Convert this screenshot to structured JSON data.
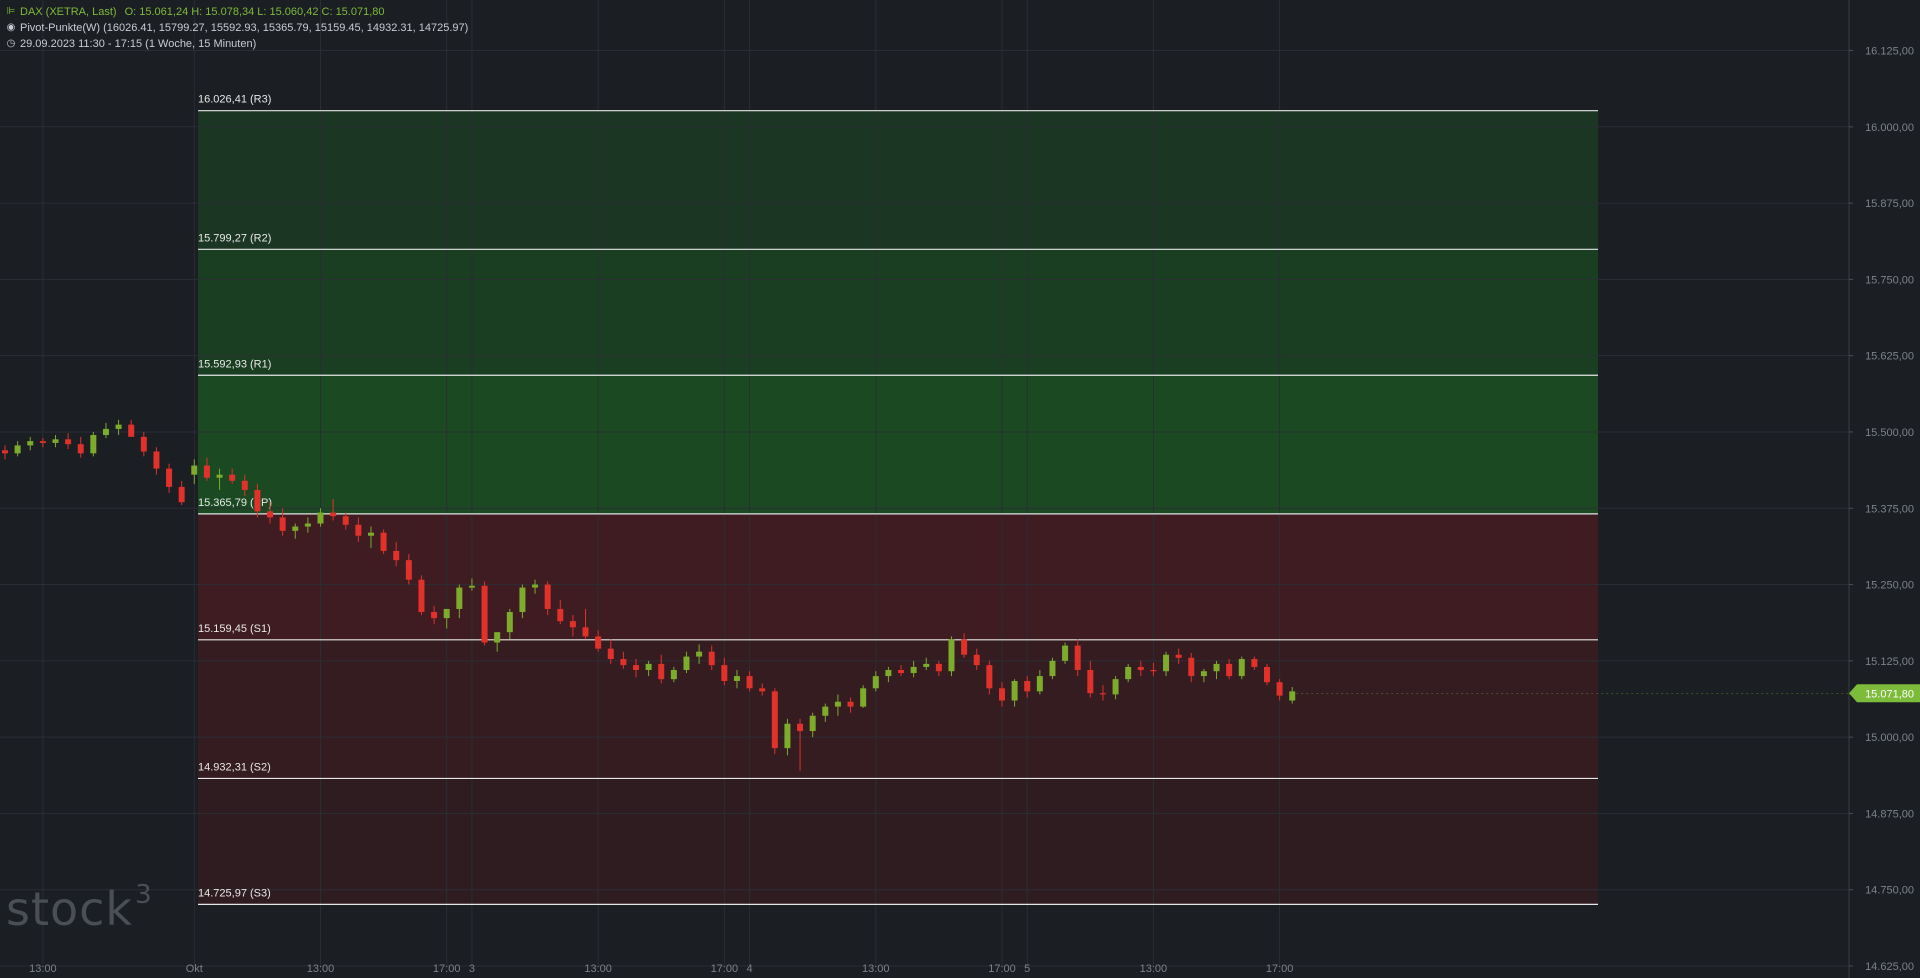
{
  "legend": {
    "symbol_icon": "candlestick-icon",
    "symbol": "DAX (XETRA, Last)",
    "ohlc": "O: 15.061,24  H: 15.078,34  L: 15.060,42  C: 15.071,80",
    "indicator_icon": "target-icon",
    "indicator": "Pivot-Punkte(W)  (16026.41,  15799.27,  15592.93,  15365.79,  15159.45,  14932.31,  14725.97)",
    "period_icon": "clock-icon",
    "period": "29.09.2023 11:30 - 17:15   (1 Woche, 15 Minuten)"
  },
  "logo": {
    "text": "stock",
    "sup": "3"
  },
  "colors": {
    "background": "#1b1e23",
    "up": "#7dab2c",
    "down": "#e0312b",
    "resistance_zone": "#1b4a22",
    "support_zone": "#3f1c21",
    "grid": "#2a2e34",
    "axis_text": "#7d828a",
    "price_tag": "#7dbb3a"
  },
  "chart_data": {
    "type": "candlestick",
    "y_axis": {
      "ticks": [
        "16.125,00",
        "16.000,00",
        "15.875,00",
        "15.750,00",
        "15.625,00",
        "15.500,00",
        "15.375,00",
        "15.250,00",
        "15.125,00",
        "15.000,00",
        "14.875,00",
        "14.750,00",
        "14.625,00"
      ],
      "tick_values": [
        16125,
        16000,
        15875,
        15750,
        15625,
        15500,
        15375,
        15250,
        15125,
        15000,
        14875,
        14750,
        14625
      ],
      "range": [
        14625,
        16175
      ]
    },
    "x_axis": {
      "tick_labels": [
        "13:00",
        "Okt",
        "13:00",
        "17:00",
        "3",
        "13:00",
        "17:00",
        "4",
        "13:00",
        "17:00",
        "5",
        "13:00",
        "17:00"
      ],
      "tick_index": [
        3,
        15,
        25,
        35,
        37,
        47,
        57,
        59,
        69,
        79,
        81,
        91,
        101
      ]
    },
    "pivot_levels": [
      {
        "label": "16.026,41 (R3)",
        "value": 16026.41
      },
      {
        "label": "15.799,27 (R2)",
        "value": 15799.27
      },
      {
        "label": "15.592,93 (R1)",
        "value": 15592.93
      },
      {
        "label": "15.365,79 (PP)",
        "value": 15365.79
      },
      {
        "label": "15.159,45 (S1)",
        "value": 15159.45
      },
      {
        "label": "14.932,31 (S2)",
        "value": 14932.31
      },
      {
        "label": "14.725,97 (S3)",
        "value": 14725.97
      }
    ],
    "last_price": {
      "label": "15.071,80",
      "value": 15071.8
    },
    "candles": [
      [
        15470,
        15478,
        15455,
        15465
      ],
      [
        15465,
        15485,
        15460,
        15478
      ],
      [
        15478,
        15492,
        15470,
        15485
      ],
      [
        15485,
        15490,
        15475,
        15482
      ],
      [
        15482,
        15495,
        15475,
        15488
      ],
      [
        15488,
        15498,
        15472,
        15480
      ],
      [
        15480,
        15492,
        15458,
        15465
      ],
      [
        15465,
        15500,
        15460,
        15495
      ],
      [
        15495,
        15515,
        15490,
        15505
      ],
      [
        15505,
        15520,
        15495,
        15512
      ],
      [
        15512,
        15520,
        15500,
        15492
      ],
      [
        15492,
        15500,
        15460,
        15468
      ],
      [
        15468,
        15475,
        15430,
        15440
      ],
      [
        15440,
        15448,
        15400,
        15410
      ],
      [
        15410,
        15420,
        15380,
        15385
      ],
      [
        15430,
        15455,
        15415,
        15445
      ],
      [
        15445,
        15458,
        15420,
        15425
      ],
      [
        15425,
        15440,
        15405,
        15430
      ],
      [
        15430,
        15440,
        15415,
        15420
      ],
      [
        15420,
        15430,
        15395,
        15405
      ],
      [
        15405,
        15415,
        15360,
        15370
      ],
      [
        15370,
        15385,
        15350,
        15360
      ],
      [
        15360,
        15375,
        15330,
        15338
      ],
      [
        15338,
        15350,
        15325,
        15345
      ],
      [
        15345,
        15360,
        15335,
        15350
      ],
      [
        15350,
        15375,
        15345,
        15368
      ],
      [
        15368,
        15390,
        15355,
        15362
      ],
      [
        15362,
        15368,
        15340,
        15348
      ],
      [
        15348,
        15360,
        15320,
        15330
      ],
      [
        15330,
        15345,
        15310,
        15335
      ],
      [
        15335,
        15340,
        15300,
        15305
      ],
      [
        15305,
        15320,
        15280,
        15290
      ],
      [
        15290,
        15300,
        15250,
        15258
      ],
      [
        15258,
        15265,
        15200,
        15205
      ],
      [
        15205,
        15215,
        15185,
        15195
      ],
      [
        15195,
        15210,
        15178,
        15210
      ],
      [
        15210,
        15250,
        15195,
        15245
      ],
      [
        15245,
        15260,
        15240,
        15248
      ],
      [
        15248,
        15255,
        15150,
        15155
      ],
      [
        15155,
        15170,
        15140,
        15172
      ],
      [
        15172,
        15210,
        15160,
        15205
      ],
      [
        15205,
        15250,
        15195,
        15245
      ],
      [
        15245,
        15258,
        15235,
        15250
      ],
      [
        15250,
        15255,
        15200,
        15210
      ],
      [
        15210,
        15225,
        15185,
        15190
      ],
      [
        15190,
        15200,
        15165,
        15180
      ],
      [
        15180,
        15210,
        15160,
        15165
      ],
      [
        15165,
        15175,
        15140,
        15145
      ],
      [
        15145,
        15160,
        15120,
        15128
      ],
      [
        15128,
        15140,
        15112,
        15118
      ],
      [
        15118,
        15128,
        15098,
        15110
      ],
      [
        15110,
        15125,
        15100,
        15120
      ],
      [
        15120,
        15135,
        15088,
        15095
      ],
      [
        15095,
        15115,
        15090,
        15110
      ],
      [
        15110,
        15140,
        15105,
        15132
      ],
      [
        15132,
        15152,
        15120,
        15140
      ],
      [
        15140,
        15150,
        15110,
        15118
      ],
      [
        15118,
        15130,
        15085,
        15092
      ],
      [
        15092,
        15110,
        15080,
        15100
      ],
      [
        15100,
        15108,
        15075,
        15080
      ],
      [
        15080,
        15088,
        15068,
        15075
      ],
      [
        15075,
        15080,
        14972,
        14982
      ],
      [
        14982,
        15030,
        14970,
        15022
      ],
      [
        15022,
        15030,
        14945,
        15010
      ],
      [
        15010,
        15040,
        15000,
        15035
      ],
      [
        15035,
        15055,
        15025,
        15050
      ],
      [
        15050,
        15070,
        15035,
        15058
      ],
      [
        15058,
        15065,
        15040,
        15050
      ],
      [
        15050,
        15085,
        15048,
        15080
      ],
      [
        15080,
        15108,
        15075,
        15100
      ],
      [
        15100,
        15115,
        15090,
        15110
      ],
      [
        15110,
        15118,
        15100,
        15105
      ],
      [
        15105,
        15125,
        15098,
        15115
      ],
      [
        15115,
        15130,
        15110,
        15120
      ],
      [
        15120,
        15125,
        15100,
        15108
      ],
      [
        15108,
        15165,
        15100,
        15160
      ],
      [
        15160,
        15170,
        15130,
        15135
      ],
      [
        15135,
        15145,
        15110,
        15118
      ],
      [
        15118,
        15125,
        15070,
        15080
      ],
      [
        15080,
        15090,
        15050,
        15060
      ],
      [
        15060,
        15095,
        15050,
        15092
      ],
      [
        15092,
        15100,
        15065,
        15075
      ],
      [
        15075,
        15110,
        15070,
        15100
      ],
      [
        15100,
        15130,
        15095,
        15125
      ],
      [
        15125,
        15155,
        15120,
        15150
      ],
      [
        15150,
        15160,
        15100,
        15110
      ],
      [
        15110,
        15125,
        15065,
        15072
      ],
      [
        15072,
        15085,
        15060,
        15070
      ],
      [
        15070,
        15100,
        15062,
        15095
      ],
      [
        15095,
        15120,
        15090,
        15115
      ],
      [
        15115,
        15125,
        15100,
        15110
      ],
      [
        15110,
        15122,
        15100,
        15108
      ],
      [
        15108,
        15140,
        15100,
        15135
      ],
      [
        15135,
        15145,
        15120,
        15130
      ],
      [
        15130,
        15138,
        15090,
        15100
      ],
      [
        15100,
        15112,
        15090,
        15108
      ],
      [
        15108,
        15125,
        15095,
        15120
      ],
      [
        15120,
        15128,
        15095,
        15100
      ],
      [
        15100,
        15132,
        15095,
        15128
      ],
      [
        15128,
        15132,
        15110,
        15115
      ],
      [
        15115,
        15120,
        15085,
        15090
      ],
      [
        15090,
        15095,
        15060,
        15068
      ],
      [
        15060,
        15082,
        15055,
        15075
      ]
    ]
  }
}
